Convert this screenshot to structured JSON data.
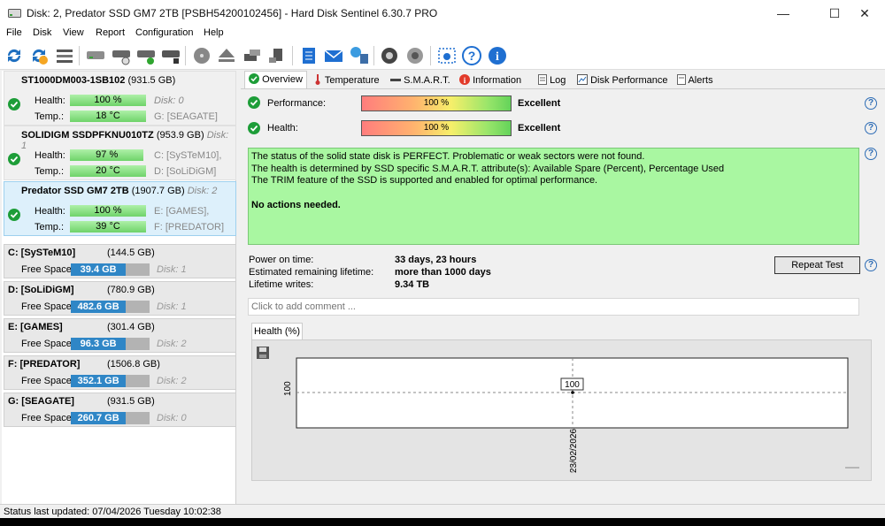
{
  "window": {
    "title": "Disk: 2, Predator SSD GM7 2TB [PSBH54200102456]  -  Hard Disk Sentinel 6.30.7 PRO",
    "minimize": "—",
    "maximize": "☐",
    "close": "✕"
  },
  "menu": [
    "File",
    "Disk",
    "View",
    "Report",
    "Configuration",
    "Help"
  ],
  "toolbar_icons": [
    "refresh-icon",
    "refresh-all-icon",
    "disk-list-icon",
    "disk-icon",
    "disk-test-icon",
    "disk-check-icon",
    "disk-info-icon",
    "surface-test-icon",
    "eject-icon",
    "disk-settings-icon",
    "disk-report-icon",
    "report-icon",
    "mail-icon",
    "network-icon",
    "settings-icon",
    "sound-icon",
    "screenshot-icon",
    "help-icon",
    "info-icon"
  ],
  "disks": [
    {
      "name": "ST1000DM003-1SB102",
      "size": "(931.5 GB)",
      "disk_label": "",
      "health_label": "Health:",
      "health": "100 %",
      "health_pct": 100,
      "temp_label": "Temp.:",
      "temp": "18 °C",
      "side1": "Disk: 0",
      "side2": "G: [SEAGATE]"
    },
    {
      "name": "SOLIDIGM SSDPFKNU010TZ",
      "size": "(953.9 GB)",
      "disk_label": "Disk: 1",
      "health_label": "Health:",
      "health": "97 %",
      "health_pct": 97,
      "temp_label": "Temp.:",
      "temp": "20 °C",
      "side1": "C: [SySTeM10],",
      "side2": "D: [SoLiDiGM]"
    },
    {
      "name": "Predator SSD GM7 2TB",
      "size": "(1907.7 GB)",
      "disk_label": "Disk: 2",
      "health_label": "Health:",
      "health": "100 %",
      "health_pct": 100,
      "temp_label": "Temp.:",
      "temp": "39 °C",
      "side1": "E: [GAMES],",
      "side2": "F: [PREDATOR]"
    }
  ],
  "partitions": [
    {
      "name": "C: [SySTeM10]",
      "size": "(144.5 GB)",
      "free_label": "Free Space",
      "free": "39.4 GB",
      "free_frac": 0.27,
      "disk": "Disk: 1"
    },
    {
      "name": "D: [SoLiDiGM]",
      "size": "(780.9 GB)",
      "free_label": "Free Space",
      "free": "482.6 GB",
      "free_frac": 0.62,
      "disk": "Disk: 1"
    },
    {
      "name": "E: [GAMES]",
      "size": "(301.4 GB)",
      "free_label": "Free Space",
      "free": "96.3 GB",
      "free_frac": 0.32,
      "disk": "Disk: 2"
    },
    {
      "name": "F: [PREDATOR]",
      "size": "(1506.8 GB)",
      "free_label": "Free Space",
      "free": "352.1 GB",
      "free_frac": 0.23,
      "disk": "Disk: 2"
    },
    {
      "name": "G: [SEAGATE]",
      "size": "(931.5 GB)",
      "free_label": "Free Space",
      "free": "260.7 GB",
      "free_frac": 0.28,
      "disk": "Disk: 0"
    }
  ],
  "tabs": [
    "Overview",
    "Temperature",
    "S.M.A.R.T.",
    "Information",
    "Log",
    "Disk Performance",
    "Alerts"
  ],
  "overview": {
    "performance_label": "Performance:",
    "performance_value": "100 %",
    "performance_rating": "Excellent",
    "health_label": "Health:",
    "health_value": "100 %",
    "health_rating": "Excellent",
    "status_lines": [
      "The status of the solid state disk is PERFECT. Problematic or weak sectors were not found.",
      "The health is determined by SSD specific S.M.A.R.T. attribute(s):  Available Spare (Percent), Percentage Used",
      "The TRIM feature of the SSD is supported and enabled for optimal performance."
    ],
    "action": "No actions needed.",
    "power_on_label": "Power on time:",
    "power_on_value": "33 days, 23 hours",
    "lifetime_label": "Estimated remaining lifetime:",
    "lifetime_value": "more than 1000 days",
    "writes_label": "Lifetime writes:",
    "writes_value": "9.34 TB",
    "repeat_button": "Repeat Test",
    "comment_placeholder": "Click to add comment ..."
  },
  "chart_tab": "Health (%)",
  "chart_data": {
    "type": "line",
    "x": [
      "23/02/2026"
    ],
    "series": [
      {
        "values": [
          100
        ]
      }
    ],
    "ylabel_tick": "100",
    "point_label": "100"
  },
  "statusbar": "Status last updated: 07/04/2026 Tuesday 10:02:38"
}
